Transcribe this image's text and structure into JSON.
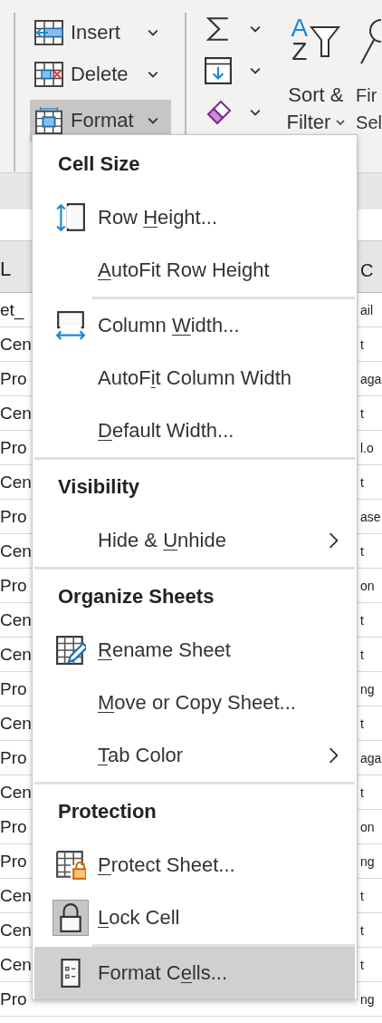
{
  "ribbon": {
    "cells_buttons": [
      {
        "kind": "insert",
        "label": "Insert",
        "selected": false
      },
      {
        "kind": "delete",
        "label": "Delete",
        "selected": false
      },
      {
        "kind": "format",
        "label": "Format",
        "selected": true
      }
    ],
    "editing_buttons": [
      {
        "kind": "sum"
      },
      {
        "kind": "fill"
      },
      {
        "kind": "clear"
      }
    ],
    "sort_filter": {
      "icon_letters": [
        "A",
        "Z"
      ],
      "label_1": "Sort &",
      "label_2": "Filter"
    },
    "find_select": {
      "label_1": "Fir",
      "label_2": "Sel"
    }
  },
  "sheet": {
    "columns": [
      "L",
      "C"
    ],
    "rows": [
      [
        "et_",
        "ail"
      ],
      [
        "Cen",
        "t"
      ],
      [
        "Pro",
        "aga"
      ],
      [
        "Cen",
        "t"
      ],
      [
        "Pro",
        "l.o"
      ],
      [
        "Cen",
        "t"
      ],
      [
        "Pro",
        "ase"
      ],
      [
        "Cen",
        "t"
      ],
      [
        "Pro",
        "on"
      ],
      [
        "Cen",
        "t"
      ],
      [
        "Cen",
        "t"
      ],
      [
        "Pro",
        "ng"
      ],
      [
        "Cen",
        "t"
      ],
      [
        "Pro",
        "aga"
      ],
      [
        "Cen",
        "t"
      ],
      [
        "Pro",
        "on"
      ],
      [
        "Pro",
        "ng"
      ],
      [
        "Cen",
        "t"
      ],
      [
        "Cen",
        "t"
      ],
      [
        "Cen",
        "t"
      ],
      [
        "Pro",
        "ng"
      ]
    ]
  },
  "menu": {
    "sections": [
      {
        "title": "Cell Size",
        "items": [
          {
            "kind": "row-height",
            "label": {
              "before": "Row ",
              "key": "H",
              "after": "eight..."
            },
            "separator_before": false,
            "submenu": false,
            "checked": false,
            "selected": false
          },
          {
            "kind": "plain",
            "label": {
              "key": "A",
              "after": "utoFit Row Height"
            },
            "separator_before": false,
            "submenu": false,
            "checked": false,
            "selected": false
          },
          {
            "kind": "column-width",
            "label": {
              "before": "Column ",
              "key": "W",
              "after": "idth..."
            },
            "separator_before": true,
            "submenu": false,
            "checked": false,
            "selected": false
          },
          {
            "kind": "plain",
            "label": {
              "before": "AutoF",
              "key": "i",
              "after": "t Column Width"
            },
            "separator_before": false,
            "submenu": false,
            "checked": false,
            "selected": false
          },
          {
            "kind": "plain",
            "label": {
              "key": "D",
              "after": "efault Width..."
            },
            "separator_before": false,
            "submenu": false,
            "checked": false,
            "selected": false
          }
        ]
      },
      {
        "title": "Visibility",
        "items": [
          {
            "kind": "plain",
            "label": {
              "before": "Hide & ",
              "key": "U",
              "after": "nhide"
            },
            "separator_before": false,
            "submenu": true,
            "checked": false,
            "selected": false
          }
        ]
      },
      {
        "title": "Organize Sheets",
        "items": [
          {
            "kind": "rename",
            "label": {
              "key": "R",
              "after": "ename Sheet"
            },
            "separator_before": false,
            "submenu": false,
            "checked": false,
            "selected": false
          },
          {
            "kind": "plain",
            "label": {
              "key": "M",
              "after": "ove or Copy Sheet..."
            },
            "separator_before": false,
            "submenu": false,
            "checked": false,
            "selected": false
          },
          {
            "kind": "plain",
            "label": {
              "key": "T",
              "after": "ab Color"
            },
            "separator_before": false,
            "submenu": true,
            "checked": false,
            "selected": false
          }
        ]
      },
      {
        "title": "Protection",
        "items": [
          {
            "kind": "protect",
            "label": {
              "key": "P",
              "after": "rotect Sheet..."
            },
            "separator_before": false,
            "submenu": false,
            "checked": false,
            "selected": false
          },
          {
            "kind": "lock",
            "label": {
              "key": "L",
              "after": "ock Cell"
            },
            "separator_before": false,
            "submenu": false,
            "checked": true,
            "selected": false
          },
          {
            "kind": "format-cells",
            "label": {
              "before": "Format C",
              "key": "e",
              "after": "lls..."
            },
            "separator_before": true,
            "submenu": false,
            "checked": false,
            "selected": true
          }
        ]
      }
    ]
  }
}
